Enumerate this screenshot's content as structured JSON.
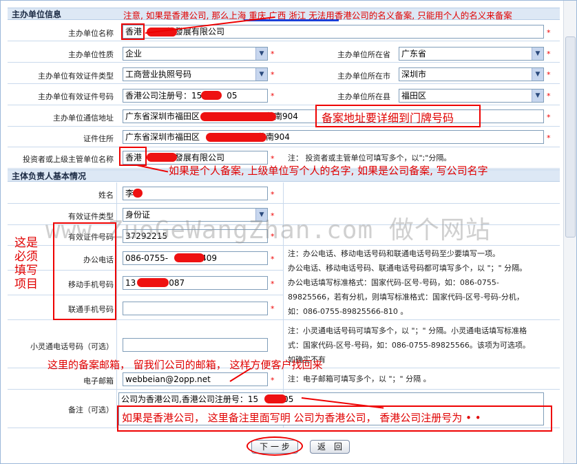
{
  "sections": {
    "unit_info": "主办单位信息",
    "person_info": "主体负责人基本情况"
  },
  "unit": {
    "name_label": "主办单位名称",
    "name_value": "香港　　　技發展有限公司",
    "nature_label": "主办单位性质",
    "nature_value": "企业",
    "province_label": "主办单位所在省",
    "province_value": "广东省",
    "cert_type_label": "主办单位有效证件类型",
    "cert_type_value": "工商营业执照号码",
    "city_label": "主办单位所在市",
    "city_value": "深圳市",
    "cert_no_label": "主办单位有效证件号码",
    "cert_no_value": "香港公司注册号：15　　　05",
    "county_label": "主办单位所在县",
    "county_value": "福田区",
    "address_label": "主办单位通信地址",
    "address_value": "广东省深圳市福田区　　　　　　　　苑南904",
    "cert_addr_label": "证件住所",
    "cert_addr_value": "广东省深圳市福田区　　　　　　　苑南904",
    "investor_label": "投资者或上级主管单位名称",
    "investor_value": "香港　　　技發展有限公司",
    "investor_note": "注： 投资者或主管单位可填写多个，以\";\"分隔。"
  },
  "person": {
    "name_label": "姓名",
    "name_value": "李",
    "cert_type_label": "有效证件类型",
    "cert_type_value": "身份证",
    "cert_no_label": "有效证件号码",
    "cert_no_value": "37292215　　　　　　",
    "office_phone_label": "办公电话",
    "office_phone_value": "086-0755-　　　　409",
    "mobile_label": "移动手机号码",
    "mobile_value": "13　　　　087",
    "unicom_label": "联通手机号码",
    "unicom_value": "",
    "phs_label": "小灵通电话号码（可选）",
    "phs_value": "",
    "email_label": "电子邮箱",
    "email_value": "webbeian@2opp.net",
    "remark_label": "备注（可选）",
    "remark_value": "公司为香港公司,香港公司注册号：15　　　05",
    "phone_note": [
      "注：办公电话、移动电话号码和联通电话号码至少要填写一项。",
      "办公电话、移动电话号码、联通电话号码都可填写多个，以 \"；\" 分隔。",
      "办公电话填写标准格式：国家代码-区号-号码，如：086-0755-",
      "89825566，若有分机，则填写标准格式：国家代码-区号-号码-分机，",
      "如：086-0755-89825566-810 。"
    ],
    "phs_note": [
      "注：小灵通电话号码可填写多个，以 \"；\" 分隔。小灵通电话填写标准格",
      "式：国家代码-区号-号码，如：086-0755-89825566。该项为可选项。",
      "如确实不有"
    ],
    "email_note": "注：电子邮箱可填写多个，以 \"；\" 分隔 。"
  },
  "buttons": {
    "next": "下 一 步",
    "back": "返　回"
  },
  "required_mark": "*",
  "annotations": {
    "top": "注意, 如果是香港公司, 那么上海  重庆  广西    浙江  无法用香港公司的名义备案, 只能用个人的名义来备案",
    "address": "备案地址要详细到门牌号码",
    "investor": "如果是个人备案, 上级单位写个人的名字, 如果是公司备案, 写公司名字",
    "required": [
      "这是",
      "必须",
      "填写",
      "项目"
    ],
    "email": "这里的备案邮箱， 留我们公司的邮箱， 这样方便客户找回来",
    "remark": "如果是香港公司， 这里备注里面写明  公司为香港公司， 香港公司注册号为 • •"
  },
  "watermark": "www.ZuoGeWangZhan.com 做个网站",
  "colors": {
    "annotation_red": "#e00000",
    "section_bg": "#dde8f5",
    "border_blue": "#7f9db9"
  }
}
